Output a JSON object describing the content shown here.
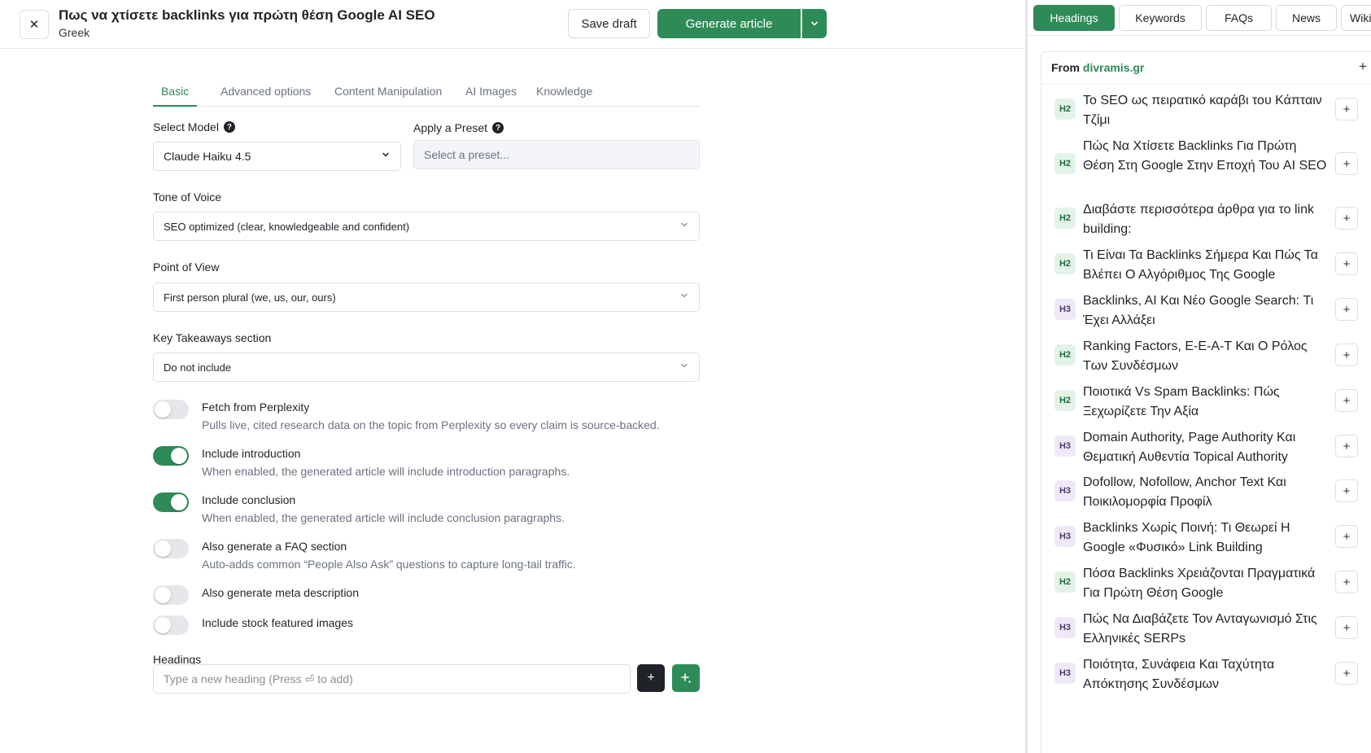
{
  "header": {
    "close_icon": "close-icon",
    "title": "Πως να χτίσετε backlinks για πρώτη θέση Google AI SEO",
    "language": "Greek",
    "save_label": "Save draft",
    "generate_label": "Generate article",
    "accent": "#2e8b57"
  },
  "tabs": [
    "Basic",
    "Advanced options",
    "Content Manipulation",
    "AI Images",
    "Knowledge"
  ],
  "active_tab": "Basic",
  "form": {
    "model_label": "Select Model",
    "model_value": "Claude Haiku 4.5",
    "preset_label": "Apply a Preset",
    "preset_placeholder": "Select a preset...",
    "tone_label": "Tone of Voice",
    "tone_value": "SEO optimized (clear, knowledgeable and confident)",
    "pov_label": "Point of View",
    "pov_value": "First person plural (we, us, our, ours)",
    "takeaways_label": "Key Takeaways section",
    "takeaways_value": "Do not include",
    "toggles": [
      {
        "title": "Fetch from Perplexity",
        "desc": "Pulls live, cited research data on the topic from Perplexity so every claim is source-backed.",
        "on": false
      },
      {
        "title": "Include introduction",
        "desc": "When enabled, the generated article will include introduction paragraphs.",
        "on": true
      },
      {
        "title": "Include conclusion",
        "desc": "When enabled, the generated article will include conclusion paragraphs.",
        "on": true
      },
      {
        "title": "Also generate a FAQ section",
        "desc": "Auto-adds common “People Also Ask” questions to capture long-tail traffic.",
        "on": false
      },
      {
        "title": "Also generate meta description",
        "desc": "",
        "on": false
      },
      {
        "title": "Include stock featured images",
        "desc": "",
        "on": false
      }
    ],
    "headings_label": "Headings",
    "heading_placeholder": "Type a new heading (Press ⏎ to add)"
  },
  "right_panel": {
    "tabs": [
      "Headings",
      "Keywords",
      "FAQs",
      "News",
      "Wiki"
    ],
    "active_tab": "Headings",
    "from_label": "From",
    "from_domain": "divramis.gr",
    "headings": [
      {
        "level": "H2",
        "text": "Το SEO ως πειρατικό καράβι του Κάπταιν Τζίμι"
      },
      {
        "level": "H2",
        "text": "Πώς Να Χτίσετε Backlinks Για Πρώτη Θέση Στη Google Στην Εποχή Του AI SEO"
      },
      {
        "level": "H2",
        "text": "Διαβάστε περισσότερα άρθρα για το link building:"
      },
      {
        "level": "H2",
        "text": "Τι Είναι Τα Backlinks Σήμερα Και Πώς Τα Βλέπει Ο Αλγόριθμος Της Google"
      },
      {
        "level": "H3",
        "text": "Backlinks, AI Και Νέο Google Search: Τι Έχει Αλλάξει"
      },
      {
        "level": "H2",
        "text": "Ranking Factors, E-E-A-T Και Ο Ρόλος Των Συνδέσμων"
      },
      {
        "level": "H2",
        "text": "Ποιοτικά Vs Spam Backlinks: Πώς Ξεχωρίζετε Την Αξία"
      },
      {
        "level": "H3",
        "text": "Domain Authority, Page Authority Και Θεματική Αυθεντία Topical Authority"
      },
      {
        "level": "H3",
        "text": "Dofollow, Nofollow, Anchor Text Και Ποικιλομορφία Προφίλ"
      },
      {
        "level": "H3",
        "text": "Backlinks Χωρίς Ποινή: Τι Θεωρεί Η Google «Φυσικό» Link Building"
      },
      {
        "level": "H2",
        "text": "Πόσα Backlinks Χρειάζονται Πραγματικά Για Πρώτη Θέση Google"
      },
      {
        "level": "H3",
        "text": "Πώς Να Διαβάζετε Τον Ανταγωνισμό Στις Ελληνικές SERPs"
      },
      {
        "level": "H3",
        "text": "Ποιότητα, Συνάφεια Και Ταχύτητα Απόκτησης Συνδέσμων"
      }
    ]
  }
}
